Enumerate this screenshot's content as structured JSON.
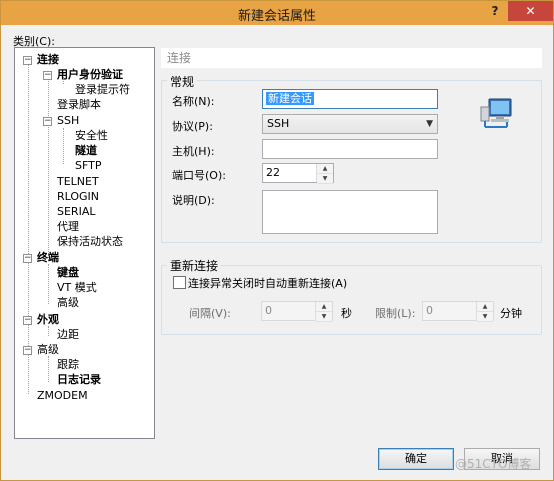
{
  "window": {
    "title": "新建会话属性",
    "help": "?",
    "close": "✕"
  },
  "category_label": "类别(C):",
  "tree": {
    "connection": "连接",
    "auth": "用户身份验证",
    "login_prompt": "登录提示符",
    "login_script": "登录脚本",
    "ssh": "SSH",
    "security": "安全性",
    "tunnel": "隧道",
    "sftp": "SFTP",
    "telnet": "TELNET",
    "rlogin": "RLOGIN",
    "serial": "SERIAL",
    "proxy": "代理",
    "keepalive": "保持活动状态",
    "terminal": "终端",
    "keyboard": "键盘",
    "vt_mode": "VT 模式",
    "term_advanced": "高级",
    "appearance": "外观",
    "margin": "边距",
    "advanced": "高级",
    "trace": "跟踪",
    "logging": "日志记录",
    "zmodem": "ZMODEM"
  },
  "section_header": "连接",
  "general": {
    "title": "常规",
    "name_label": "名称(N):",
    "name_value": "新建会话",
    "protocol_label": "协议(P):",
    "protocol_value": "SSH",
    "host_label": "主机(H):",
    "host_value": "",
    "port_label": "端口号(O):",
    "port_value": "22",
    "desc_label": "说明(D):",
    "desc_value": ""
  },
  "reconnect": {
    "title": "重新连接",
    "auto_label": "连接异常关闭时自动重新连接(A)",
    "interval_label": "间隔(V):",
    "interval_value": "0",
    "sec_unit": "秒",
    "limit_label": "限制(L):",
    "limit_value": "0",
    "min_unit": "分钟"
  },
  "buttons": {
    "ok": "确定",
    "cancel": "取消"
  },
  "watermark": "@51CTO博客",
  "icons": {
    "expanded": "−",
    "spin_up": "▲",
    "spin_down": "▼",
    "dropdown": "▼"
  }
}
